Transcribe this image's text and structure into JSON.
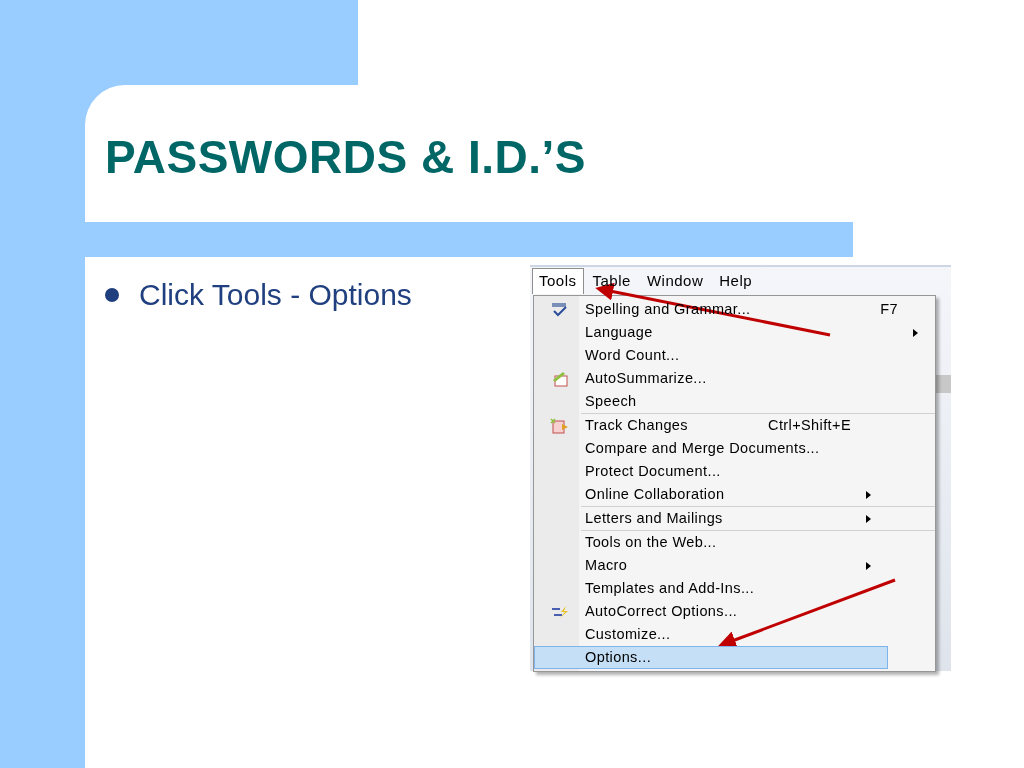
{
  "slide": {
    "title": "PASSWORDS & I.D.’S",
    "bullets": [
      "Click Tools - Options"
    ]
  },
  "menu_bar": [
    {
      "label": "Tools",
      "selected": true
    },
    {
      "label": "Table",
      "selected": false
    },
    {
      "label": "Window",
      "selected": false
    },
    {
      "label": "Help",
      "selected": false
    }
  ],
  "menu_groups": [
    [
      {
        "label": "Spelling and Grammar...",
        "shortcut": "F7",
        "kind": "spelling",
        "submenu": false,
        "selected": false
      },
      {
        "label": "Language",
        "submenu": true,
        "selected": false
      },
      {
        "label": "Word Count...",
        "submenu": false,
        "selected": false
      },
      {
        "label": "AutoSummarize...",
        "kind": "summarize",
        "submenu": false,
        "selected": false
      },
      {
        "label": "Speech",
        "submenu": false,
        "selected": false
      }
    ],
    [
      {
        "label": "Track Changes",
        "shortcut": "Ctrl+Shift+E",
        "kind": "track",
        "submenu": false,
        "selected": false
      },
      {
        "label": "Compare and Merge Documents...",
        "submenu": false,
        "selected": false
      },
      {
        "label": "Protect Document...",
        "submenu": false,
        "selected": false
      },
      {
        "label": "Online Collaboration",
        "submenu": true,
        "selected": false
      }
    ],
    [
      {
        "label": "Letters and Mailings",
        "submenu": true,
        "selected": false
      }
    ],
    [
      {
        "label": "Tools on the Web...",
        "submenu": false,
        "selected": false
      },
      {
        "label": "Macro",
        "submenu": true,
        "selected": false
      },
      {
        "label": "Templates and Add-Ins...",
        "submenu": false,
        "selected": false
      },
      {
        "label": "AutoCorrect Options...",
        "kind": "autocorrect",
        "submenu": false,
        "selected": false
      },
      {
        "label": "Customize...",
        "submenu": false,
        "selected": false
      },
      {
        "label": "Options...",
        "submenu": false,
        "selected": true
      }
    ]
  ]
}
